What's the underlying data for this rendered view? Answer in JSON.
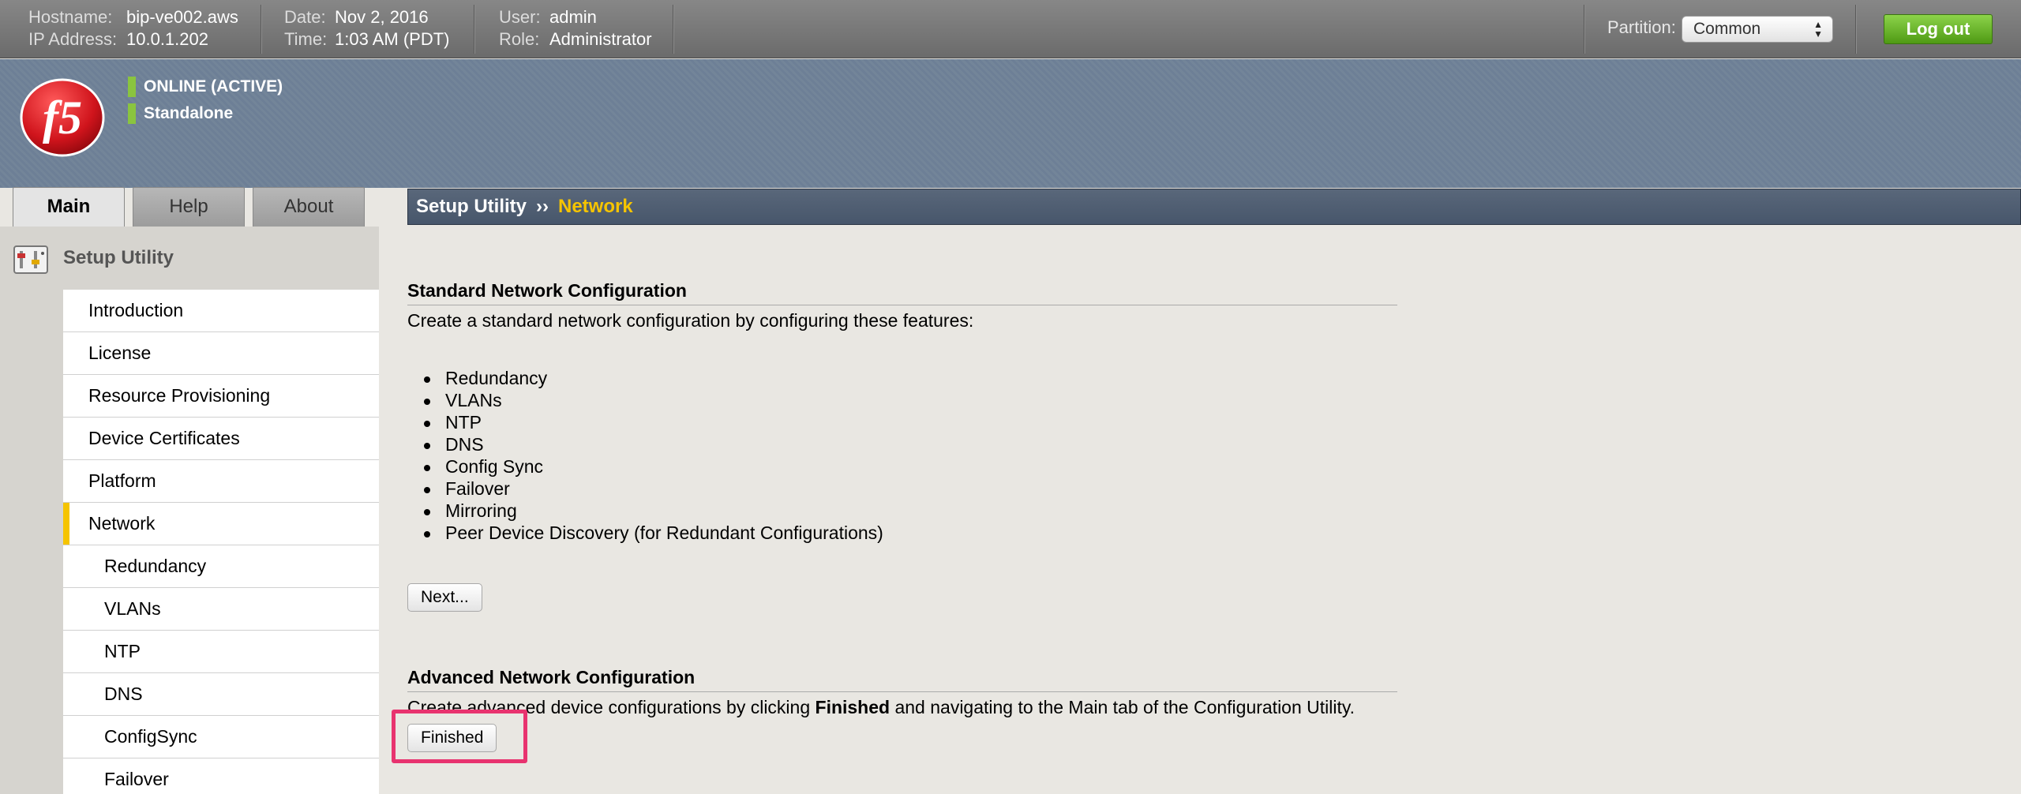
{
  "topbar": {
    "hostname_label": "Hostname:",
    "hostname": "bip-ve002.aws",
    "ip_label": "IP Address:",
    "ip": "10.0.1.202",
    "date_label": "Date:",
    "date": "Nov 2, 2016",
    "time_label": "Time:",
    "time": "1:03 AM (PDT)",
    "user_label": "User:",
    "user": "admin",
    "role_label": "Role:",
    "role": "Administrator",
    "partition_label": "Partition:",
    "partition_value": "Common",
    "logout_label": "Log out"
  },
  "banner": {
    "logo_text": "f5",
    "status": "ONLINE (ACTIVE)",
    "mode": "Standalone",
    "status_color": "#8ac43f"
  },
  "tabs": [
    "Main",
    "Help",
    "About"
  ],
  "breadcrumb": {
    "root": "Setup Utility",
    "separator": "››",
    "current": "Network"
  },
  "sidebar": {
    "title": "Setup Utility",
    "items": [
      {
        "label": "Introduction"
      },
      {
        "label": "License"
      },
      {
        "label": "Resource Provisioning"
      },
      {
        "label": "Device Certificates"
      },
      {
        "label": "Platform"
      },
      {
        "label": "Network"
      },
      {
        "label": "Redundancy"
      },
      {
        "label": "VLANs"
      },
      {
        "label": "NTP"
      },
      {
        "label": "DNS"
      },
      {
        "label": "ConfigSync"
      },
      {
        "label": "Failover"
      }
    ]
  },
  "main": {
    "standard_title": "Standard Network Configuration",
    "standard_desc": "Create a standard network configuration by configuring these features:",
    "features": [
      "Redundancy",
      "VLANs",
      "NTP",
      "DNS",
      "Config Sync",
      "Failover",
      "Mirroring",
      "Peer Device Discovery (for Redundant Configurations)"
    ],
    "next_label": "Next...",
    "advanced_title": "Advanced Network Configuration",
    "advanced_desc_pre": "Create advanced device configurations by clicking ",
    "advanced_desc_bold": "Finished",
    "advanced_desc_post": " and navigating to the Main tab of the Configuration Utility.",
    "finished_label": "Finished"
  },
  "colors": {
    "accent_yellow": "#f5c400",
    "logout_green": "#5aa81c",
    "highlight": "#e8336f"
  }
}
